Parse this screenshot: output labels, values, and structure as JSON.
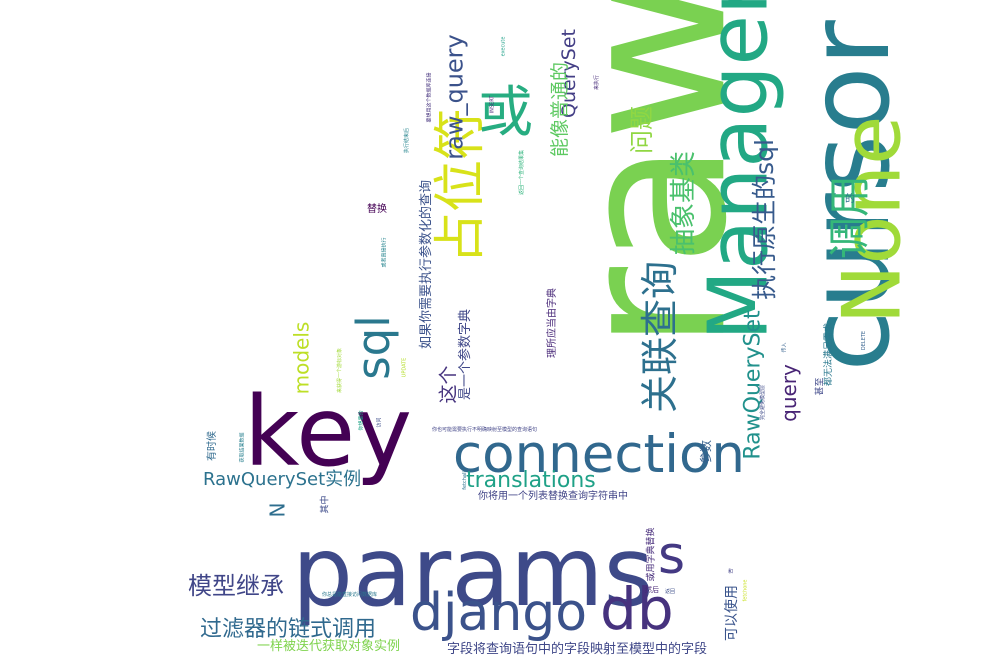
{
  "words": [
    {
      "text": "raw",
      "color": "#7ad151"
    },
    {
      "text": "cursor",
      "color": "#287d8e"
    },
    {
      "text": "params",
      "color": "#3e4a89"
    },
    {
      "text": "key",
      "color": "#440154"
    },
    {
      "text": "Manager",
      "color": "#22a884"
    },
    {
      "text": "None",
      "color": "#a0da39"
    },
    {
      "text": "connection",
      "color": "#31688e"
    },
    {
      "text": "占位符",
      "color": "#d8e219"
    },
    {
      "text": "或",
      "color": "#27ad81"
    },
    {
      "text": "django",
      "color": "#3b528b"
    },
    {
      "text": "db",
      "color": "#46327e"
    },
    {
      "text": "s",
      "color": "#443983"
    },
    {
      "text": "调用",
      "color": "#35b779"
    },
    {
      "text": "sql",
      "color": "#2a788e"
    },
    {
      "text": "关联查询",
      "color": "#2d708e"
    },
    {
      "text": "抽象基类",
      "color": "#4ac16d"
    },
    {
      "text": "执行原生的sql",
      "color": "#375a8c"
    },
    {
      "text": "RawQuerySet",
      "color": "#21918c"
    },
    {
      "text": "query",
      "color": "#482475"
    },
    {
      "text": "translations",
      "color": "#1fa187"
    },
    {
      "text": "RawQuerySet实例",
      "color": "#2c728e"
    },
    {
      "text": "模型继承",
      "color": "#404688"
    },
    {
      "text": "过滤器的链式调用",
      "color": "#30698e"
    },
    {
      "text": "raw_query",
      "color": "#3b528b"
    },
    {
      "text": "QuerySet",
      "color": "#433e85"
    },
    {
      "text": "能像普通的",
      "color": "#5ec962"
    },
    {
      "text": "问题",
      "color": "#90d743"
    },
    {
      "text": "models",
      "color": "#bddf26"
    },
    {
      "text": "如果你需要执行参数化的查询",
      "color": "#3b528b"
    },
    {
      "text": "这个",
      "color": "#46337e"
    },
    {
      "text": "是一个参数字典",
      "color": "#3f4788"
    },
    {
      "text": "理所应当由字典",
      "color": "#482878"
    },
    {
      "text": "可以使用",
      "color": "#3a548c"
    },
    {
      "text": "N",
      "color": "#2e6e8e"
    },
    {
      "text": "一样被迭代获取对象实例",
      "color": "#7fd34e"
    },
    {
      "text": "字段将查询语句中的字段映射至模型中的字段",
      "color": "#3f4788"
    },
    {
      "text": "你将用一个列表替换查询字符串中",
      "color": "#414487"
    },
    {
      "text": "参数",
      "color": "#355f8d"
    },
    {
      "text": "的",
      "color": "#2d708e"
    },
    {
      "text": "替换",
      "color": "#440154"
    },
    {
      "text": "有时候",
      "color": "#306a8e"
    },
    {
      "text": "其中",
      "color": "#3e4c8a"
    },
    {
      "text": "甚至",
      "color": "#3f4889"
    },
    {
      "text": "都无法满足需求",
      "color": "#2a788e"
    },
    {
      "text": "或用字典替换",
      "color": "#472d7b"
    },
    {
      "text": "然后",
      "color": "#482475"
    },
    {
      "text": "你也可能需要执行不明确映射至模型的查询语句",
      "color": "#414487"
    },
    {
      "text": "你总是能直接访问数据库",
      "color": "#2a788e"
    },
    {
      "text": "完全避免模型层",
      "color": "#3e4a89"
    },
    {
      "text": "DELETE",
      "color": "#34618d"
    },
    {
      "text": "你想要的",
      "color": "#20a386"
    },
    {
      "text": "返回一个查询结果集",
      "color": "#2fb47c"
    },
    {
      "text": "要想用这个数据库连接",
      "color": "#46337e"
    },
    {
      "text": "执行结束后",
      "color": "#25848e"
    },
    {
      "text": "或者直接执行",
      "color": "#25848e"
    },
    {
      "text": "获取结果数据",
      "color": "#277f8e"
    },
    {
      "text": "来获得一个游标对象",
      "color": "#a2da37"
    },
    {
      "text": "UPDATE",
      "color": "#b5de2b"
    },
    {
      "text": "INSERT",
      "color": "#482677"
    },
    {
      "text": "execute",
      "color": "#1fa188"
    },
    {
      "text": "fetchall",
      "color": "#2c738e"
    },
    {
      "text": "fetchone",
      "color": "#c8e020"
    },
    {
      "text": "来执行",
      "color": "#472c7a"
    },
    {
      "text": "访问",
      "color": "#3d4d8a"
    },
    {
      "text": "和",
      "color": "#424186"
    },
    {
      "text": "返回",
      "color": "#3d4e8a"
    },
    {
      "text": "传入",
      "color": "#34618d"
    }
  ]
}
